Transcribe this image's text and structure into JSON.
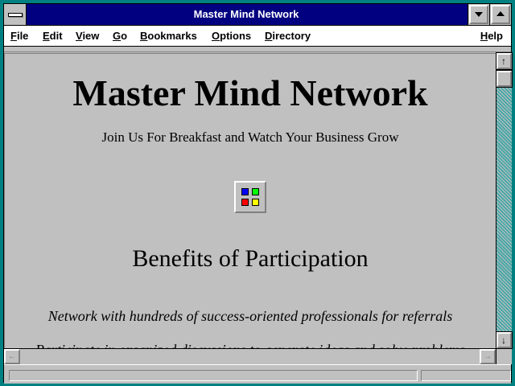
{
  "window": {
    "title": "Master Mind Network"
  },
  "menu": {
    "items": [
      {
        "label": "File"
      },
      {
        "label": "Edit"
      },
      {
        "label": "View"
      },
      {
        "label": "Go"
      },
      {
        "label": "Bookmarks"
      },
      {
        "label": "Options"
      },
      {
        "label": "Directory"
      }
    ],
    "help": "Help"
  },
  "page": {
    "heading": "Master Mind Network",
    "subheading": "Join Us For Breakfast and Watch Your Business Grow",
    "logo_icon": "four-colored-squares-icon",
    "logo_colors": [
      "#0000ff",
      "#00ff00",
      "#ff0000",
      "#ffff00"
    ],
    "benefits_title": "Benefits of Participation",
    "benefits": [
      "Network with hundreds of success-oriented professionals for referrals",
      "Participate in organized discussions to generate ideas and solve problems"
    ]
  },
  "status": {
    "text": ""
  },
  "colors": {
    "title_bar": "#000080",
    "window_frame": "#008080",
    "background": "#c0c0c0"
  }
}
